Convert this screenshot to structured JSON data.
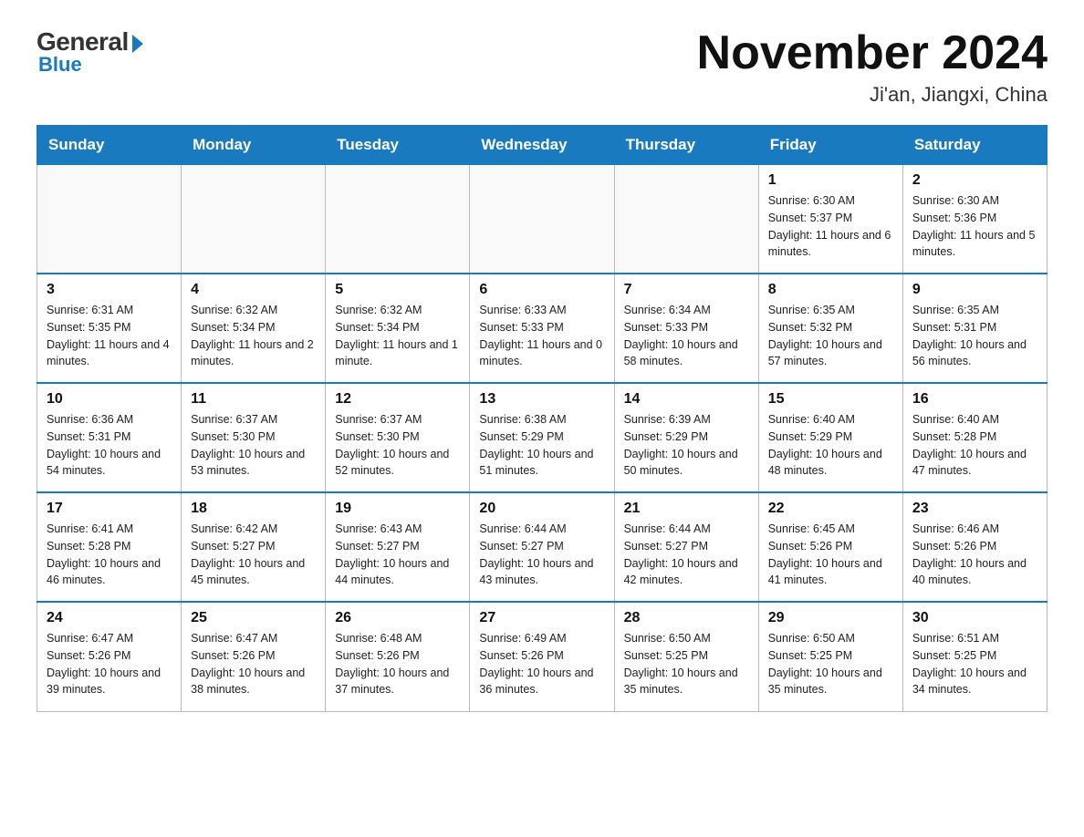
{
  "header": {
    "logo_general": "General",
    "logo_blue": "Blue",
    "month_title": "November 2024",
    "location": "Ji'an, Jiangxi, China"
  },
  "days_of_week": [
    "Sunday",
    "Monday",
    "Tuesday",
    "Wednesday",
    "Thursday",
    "Friday",
    "Saturday"
  ],
  "weeks": [
    [
      {
        "day": "",
        "info": ""
      },
      {
        "day": "",
        "info": ""
      },
      {
        "day": "",
        "info": ""
      },
      {
        "day": "",
        "info": ""
      },
      {
        "day": "",
        "info": ""
      },
      {
        "day": "1",
        "info": "Sunrise: 6:30 AM\nSunset: 5:37 PM\nDaylight: 11 hours and 6 minutes."
      },
      {
        "day": "2",
        "info": "Sunrise: 6:30 AM\nSunset: 5:36 PM\nDaylight: 11 hours and 5 minutes."
      }
    ],
    [
      {
        "day": "3",
        "info": "Sunrise: 6:31 AM\nSunset: 5:35 PM\nDaylight: 11 hours and 4 minutes."
      },
      {
        "day": "4",
        "info": "Sunrise: 6:32 AM\nSunset: 5:34 PM\nDaylight: 11 hours and 2 minutes."
      },
      {
        "day": "5",
        "info": "Sunrise: 6:32 AM\nSunset: 5:34 PM\nDaylight: 11 hours and 1 minute."
      },
      {
        "day": "6",
        "info": "Sunrise: 6:33 AM\nSunset: 5:33 PM\nDaylight: 11 hours and 0 minutes."
      },
      {
        "day": "7",
        "info": "Sunrise: 6:34 AM\nSunset: 5:33 PM\nDaylight: 10 hours and 58 minutes."
      },
      {
        "day": "8",
        "info": "Sunrise: 6:35 AM\nSunset: 5:32 PM\nDaylight: 10 hours and 57 minutes."
      },
      {
        "day": "9",
        "info": "Sunrise: 6:35 AM\nSunset: 5:31 PM\nDaylight: 10 hours and 56 minutes."
      }
    ],
    [
      {
        "day": "10",
        "info": "Sunrise: 6:36 AM\nSunset: 5:31 PM\nDaylight: 10 hours and 54 minutes."
      },
      {
        "day": "11",
        "info": "Sunrise: 6:37 AM\nSunset: 5:30 PM\nDaylight: 10 hours and 53 minutes."
      },
      {
        "day": "12",
        "info": "Sunrise: 6:37 AM\nSunset: 5:30 PM\nDaylight: 10 hours and 52 minutes."
      },
      {
        "day": "13",
        "info": "Sunrise: 6:38 AM\nSunset: 5:29 PM\nDaylight: 10 hours and 51 minutes."
      },
      {
        "day": "14",
        "info": "Sunrise: 6:39 AM\nSunset: 5:29 PM\nDaylight: 10 hours and 50 minutes."
      },
      {
        "day": "15",
        "info": "Sunrise: 6:40 AM\nSunset: 5:29 PM\nDaylight: 10 hours and 48 minutes."
      },
      {
        "day": "16",
        "info": "Sunrise: 6:40 AM\nSunset: 5:28 PM\nDaylight: 10 hours and 47 minutes."
      }
    ],
    [
      {
        "day": "17",
        "info": "Sunrise: 6:41 AM\nSunset: 5:28 PM\nDaylight: 10 hours and 46 minutes."
      },
      {
        "day": "18",
        "info": "Sunrise: 6:42 AM\nSunset: 5:27 PM\nDaylight: 10 hours and 45 minutes."
      },
      {
        "day": "19",
        "info": "Sunrise: 6:43 AM\nSunset: 5:27 PM\nDaylight: 10 hours and 44 minutes."
      },
      {
        "day": "20",
        "info": "Sunrise: 6:44 AM\nSunset: 5:27 PM\nDaylight: 10 hours and 43 minutes."
      },
      {
        "day": "21",
        "info": "Sunrise: 6:44 AM\nSunset: 5:27 PM\nDaylight: 10 hours and 42 minutes."
      },
      {
        "day": "22",
        "info": "Sunrise: 6:45 AM\nSunset: 5:26 PM\nDaylight: 10 hours and 41 minutes."
      },
      {
        "day": "23",
        "info": "Sunrise: 6:46 AM\nSunset: 5:26 PM\nDaylight: 10 hours and 40 minutes."
      }
    ],
    [
      {
        "day": "24",
        "info": "Sunrise: 6:47 AM\nSunset: 5:26 PM\nDaylight: 10 hours and 39 minutes."
      },
      {
        "day": "25",
        "info": "Sunrise: 6:47 AM\nSunset: 5:26 PM\nDaylight: 10 hours and 38 minutes."
      },
      {
        "day": "26",
        "info": "Sunrise: 6:48 AM\nSunset: 5:26 PM\nDaylight: 10 hours and 37 minutes."
      },
      {
        "day": "27",
        "info": "Sunrise: 6:49 AM\nSunset: 5:26 PM\nDaylight: 10 hours and 36 minutes."
      },
      {
        "day": "28",
        "info": "Sunrise: 6:50 AM\nSunset: 5:25 PM\nDaylight: 10 hours and 35 minutes."
      },
      {
        "day": "29",
        "info": "Sunrise: 6:50 AM\nSunset: 5:25 PM\nDaylight: 10 hours and 35 minutes."
      },
      {
        "day": "30",
        "info": "Sunrise: 6:51 AM\nSunset: 5:25 PM\nDaylight: 10 hours and 34 minutes."
      }
    ]
  ]
}
